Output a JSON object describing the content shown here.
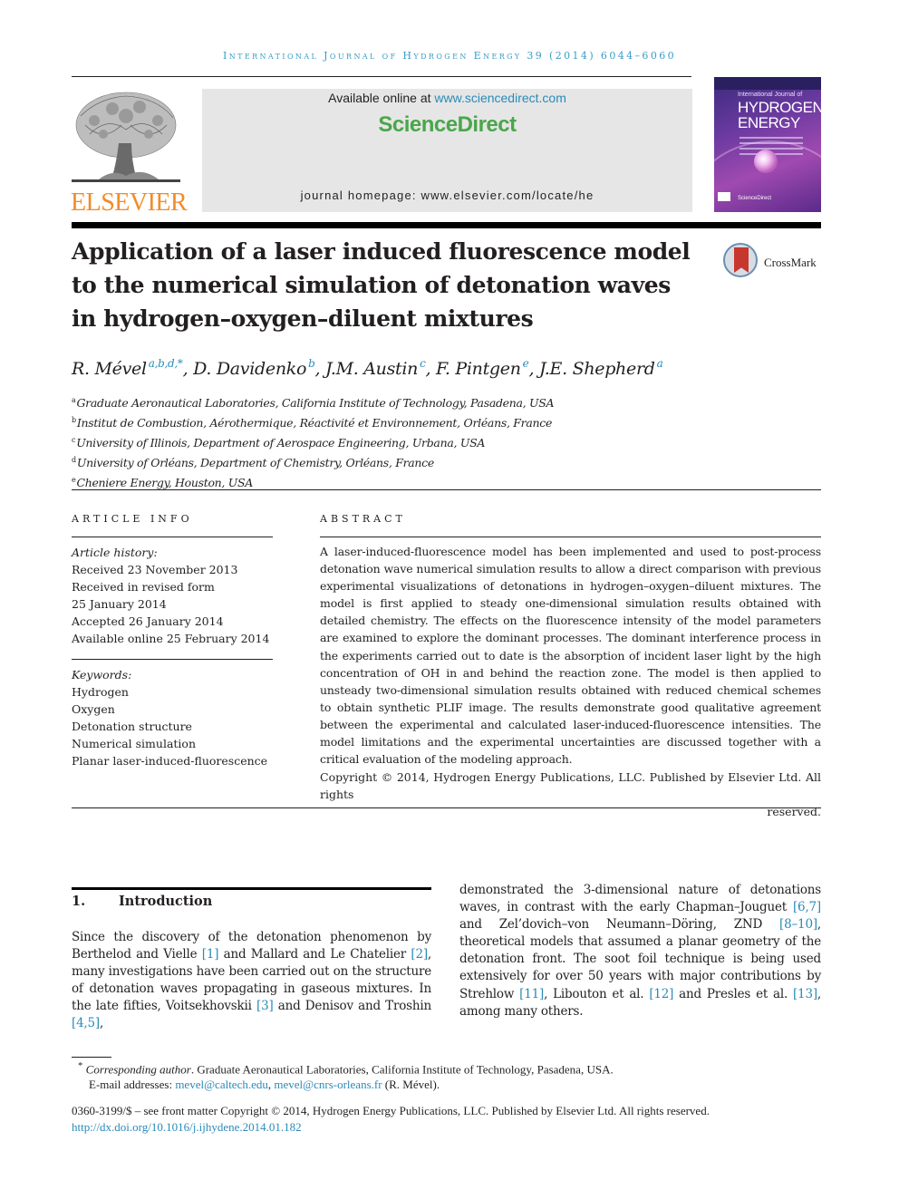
{
  "running_header": "International Journal of Hydrogen Energy 39 (2014) 6044–6060",
  "masthead": {
    "available_prefix": "Available online at ",
    "available_link": "www.sciencedirect.com",
    "brand": "ScienceDirect",
    "homepage_prefix": "journal homepage: ",
    "homepage_url": "www.elsevier.com/locate/he"
  },
  "publisher_logo": {
    "icon": "elsevier-tree-icon",
    "wordmark": "ELSEVIER"
  },
  "journal_cover": {
    "line1": "International Journal of",
    "line2": "HYDROGEN",
    "line3": "ENERGY",
    "footer": "ScienceDirect"
  },
  "crossmark": {
    "label": "CrossMark",
    "icon": "crossmark-icon"
  },
  "title": {
    "line1": "Application of a laser induced fluorescence model",
    "line2": "to the numerical simulation of detonation waves",
    "line3": "in hydrogen–oxygen–diluent mixtures"
  },
  "authors": [
    {
      "name": "R. Mével",
      "sup": "a,b,d,*"
    },
    {
      "name": "D. Davidenko",
      "sup": "b"
    },
    {
      "name": "J.M. Austin",
      "sup": "c"
    },
    {
      "name": "F. Pintgen",
      "sup": "e"
    },
    {
      "name": "J.E. Shepherd",
      "sup": "a"
    }
  ],
  "author_separator": ", ",
  "affiliations": [
    {
      "key": "a",
      "text": "Graduate Aeronautical Laboratories, California Institute of Technology, Pasadena, USA"
    },
    {
      "key": "b",
      "text": "Institut de Combustion, Aérothermique, Réactivité et Environnement, Orléans, France"
    },
    {
      "key": "c",
      "text": "University of Illinois, Department of Aerospace Engineering, Urbana, USA"
    },
    {
      "key": "d",
      "text": "University of Orléans, Department of Chemistry, Orléans, France"
    },
    {
      "key": "e",
      "text": "Cheniere Energy, Houston, USA"
    }
  ],
  "article_info": {
    "label": "ARTICLE INFO",
    "history_label": "Article history:",
    "history": [
      "Received 23 November 2013",
      "Received in revised form",
      "25 January 2014",
      "Accepted 26 January 2014",
      "Available online 25 February 2014"
    ],
    "keywords_label": "Keywords:",
    "keywords": [
      "Hydrogen",
      "Oxygen",
      "Detonation structure",
      "Numerical simulation",
      "Planar laser-induced-fluorescence"
    ]
  },
  "abstract": {
    "label": "ABSTRACT",
    "text": "A laser-induced-fluorescence model has been implemented and used to post-process detonation wave numerical simulation results to allow a direct comparison with previous experimental visualizations of detonations in hydrogen–oxygen–diluent mixtures. The model is first applied to steady one-dimensional simulation results obtained with detailed chemistry. The effects on the fluorescence intensity of the model parameters are examined to explore the dominant processes. The dominant interference process in the experiments carried out to date is the absorption of incident laser light by the high concentration of OH in and behind the reaction zone. The model is then applied to unsteady two-dimensional simulation results obtained with reduced chemical schemes to obtain synthetic PLIF image. The results demonstrate good qualitative agreement between the experimental and calculated laser-induced-fluorescence intensities. The model limitations and the experimental uncertainties are discussed together with a critical evaluation of the modeling approach.",
    "copyright_line1": "Copyright © 2014, Hydrogen Energy Publications, LLC. Published by Elsevier Ltd. All rights",
    "copyright_line2": "reserved."
  },
  "introduction": {
    "number": "1.",
    "heading": "Introduction",
    "left_segments": [
      {
        "t": "Since the discovery of the detonation phenomenon by Berthelod and Vielle "
      },
      {
        "ref": "[1]"
      },
      {
        "t": " and Mallard and Le Chatelier "
      },
      {
        "ref": "[2]"
      },
      {
        "t": ", many investigations have been carried out on the structure of detonation waves propagating in gaseous mixtures. In the late fifties, Voitsekhovskii "
      },
      {
        "ref": "[3]"
      },
      {
        "t": " and Denisov and Troshin "
      },
      {
        "ref": "[4,5]"
      },
      {
        "t": ","
      }
    ],
    "right_segments": [
      {
        "t": "demonstrated the 3-dimensional nature of detonations waves, in contrast with the early Chapman–Jouguet "
      },
      {
        "ref": "[6,7]"
      },
      {
        "t": " and Zel’dovich–von Neumann–Döring, ZND "
      },
      {
        "ref": "[8–10]"
      },
      {
        "t": ", theoretical models that assumed a planar geometry of the detonation front. The soot foil technique is being used extensively for over 50 years with major contributions by Strehlow "
      },
      {
        "ref": "[11]"
      },
      {
        "t": ", Libouton et al. "
      },
      {
        "ref": "[12]"
      },
      {
        "t": " and Presles et al. "
      },
      {
        "ref": "[13]"
      },
      {
        "t": ", among many others."
      }
    ]
  },
  "footnote": {
    "marker": "*",
    "label": "Corresponding author",
    "text": ". Graduate Aeronautical Laboratories, California Institute of Technology, Pasadena, USA.",
    "email_label": "E-mail addresses: ",
    "emails": [
      "mevel@caltech.edu",
      "mevel@cnrs-orleans.fr"
    ],
    "email_suffix": " (R. Mével)."
  },
  "issn_line": "0360-3199/$ – see front matter Copyright © 2014, Hydrogen Energy Publications, LLC. Published by Elsevier Ltd. All rights reserved.",
  "doi": "http://dx.doi.org/10.1016/j.ijhydene.2014.01.182",
  "colors": {
    "link": "#2a8ab8",
    "running_header": "#3a9cc7",
    "sciencedirect_green": "#4aa64a",
    "elsevier_orange": "#f28c28",
    "masthead_gray": "#e6e6e6"
  }
}
